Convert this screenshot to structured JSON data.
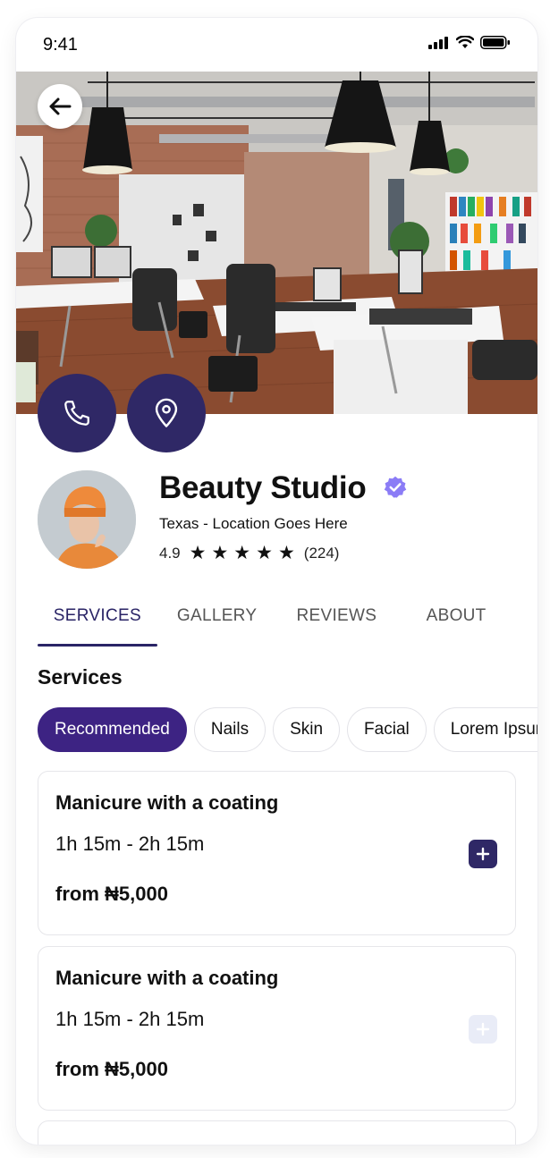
{
  "status_bar": {
    "time": "9:41"
  },
  "business": {
    "name": "Beauty Studio",
    "location": "Texas - Location Goes Here",
    "rating": "4.9",
    "stars": 5,
    "review_count": "(224)"
  },
  "tabs": [
    {
      "label": "SERVICES",
      "active": true
    },
    {
      "label": "GALLERY",
      "active": false
    },
    {
      "label": "REVIEWS",
      "active": false
    },
    {
      "label": "ABOUT",
      "active": false
    }
  ],
  "section_title": "Services",
  "chips": [
    {
      "label": "Recommended",
      "active": true
    },
    {
      "label": "Nails",
      "active": false
    },
    {
      "label": "Skin",
      "active": false
    },
    {
      "label": "Facial",
      "active": false
    },
    {
      "label": "Lorem Ipsum",
      "active": false
    }
  ],
  "services": [
    {
      "title": "Manicure with a coating",
      "duration": "1h 15m - 2h 15m",
      "price": "from ₦5,000",
      "add_enabled": true
    },
    {
      "title": "Manicure with a coating",
      "duration": "1h 15m - 2h 15m",
      "price": "from ₦5,000",
      "add_enabled": false
    }
  ],
  "icons": {
    "back": "arrow-left-icon",
    "call": "phone-icon",
    "location": "map-pin-icon",
    "verified": "verified-badge-icon",
    "add": "plus-icon"
  },
  "colors": {
    "primary": "#2f2866",
    "chip_active": "#3d2383",
    "verified": "#8b7cf6",
    "add_disabled": "#e9ecf7"
  }
}
